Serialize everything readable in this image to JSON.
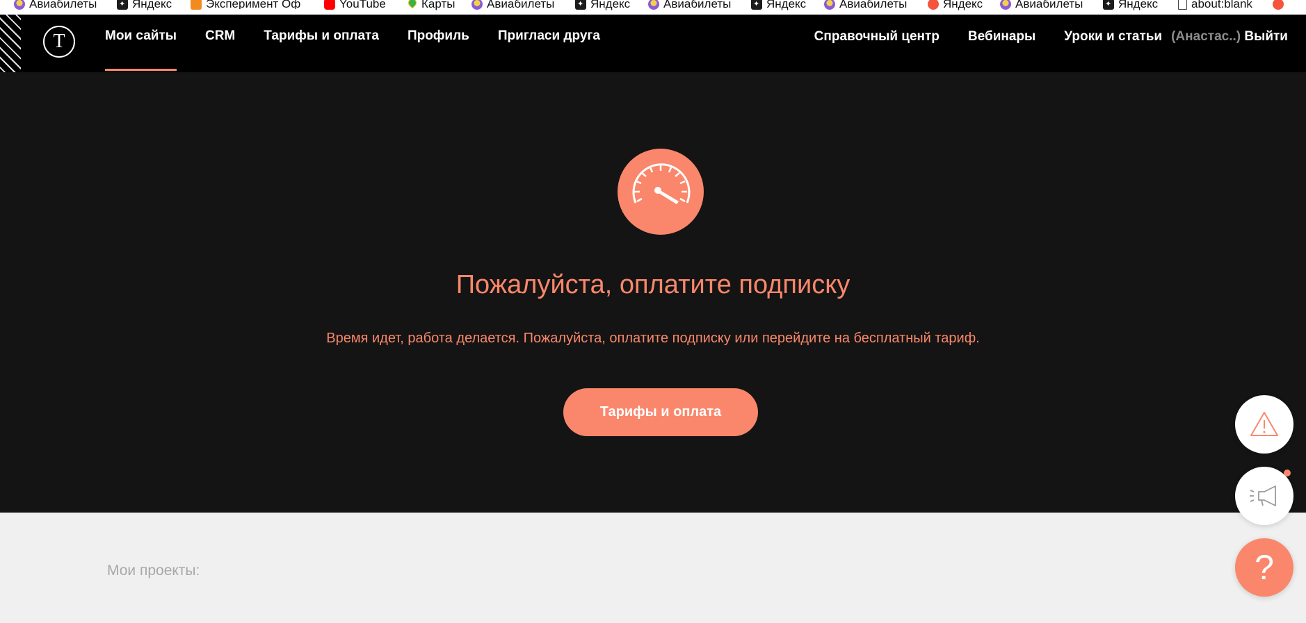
{
  "bookmarks": [
    {
      "label": "Авиабилеты",
      "icon": "avia-icon"
    },
    {
      "label": "Яндекс",
      "icon": "yandex-icon"
    },
    {
      "label": "Эксперимент Оф",
      "icon": "experiment-icon"
    },
    {
      "label": "YouTube",
      "icon": "youtube-icon"
    },
    {
      "label": "Карты",
      "icon": "maps-icon"
    },
    {
      "label": "Авиабилеты",
      "icon": "avia-icon"
    },
    {
      "label": "Яндекс",
      "icon": "yandex-icon"
    },
    {
      "label": "Авиабилеты",
      "icon": "avia-icon"
    },
    {
      "label": "Яндекс",
      "icon": "yandex-icon"
    },
    {
      "label": "Авиабилеты",
      "icon": "avia-icon"
    },
    {
      "label": "Яндекс",
      "icon": "yandex-red-icon"
    },
    {
      "label": "Авиабилеты",
      "icon": "avia-icon"
    },
    {
      "label": "Яндекс",
      "icon": "yandex-icon"
    },
    {
      "label": "about:blank",
      "icon": "blank-page-icon"
    }
  ],
  "nav": {
    "logo": "T",
    "left": [
      "Мои сайты",
      "CRM",
      "Тарифы и оплата",
      "Профиль",
      "Пригласи друга"
    ],
    "right": [
      "Справочный центр",
      "Вебинары",
      "Уроки и статьи"
    ],
    "user": "(Анастас..)",
    "logout": "Выйти"
  },
  "hero": {
    "title": "Пожалуйста, оплатите подписку",
    "subtitle": "Время идет, работа делается. Пожалуйста, оплатите подписку или перейдите на бесплатный тариф.",
    "button": "Тарифы и оплата"
  },
  "projects": {
    "label": "Мои проекты:"
  },
  "floating": {
    "help_label": "?"
  },
  "colors": {
    "accent": "#fa876b",
    "nav_bg": "#000000",
    "hero_bg": "#141414",
    "page_bg": "#f0f0f0"
  }
}
